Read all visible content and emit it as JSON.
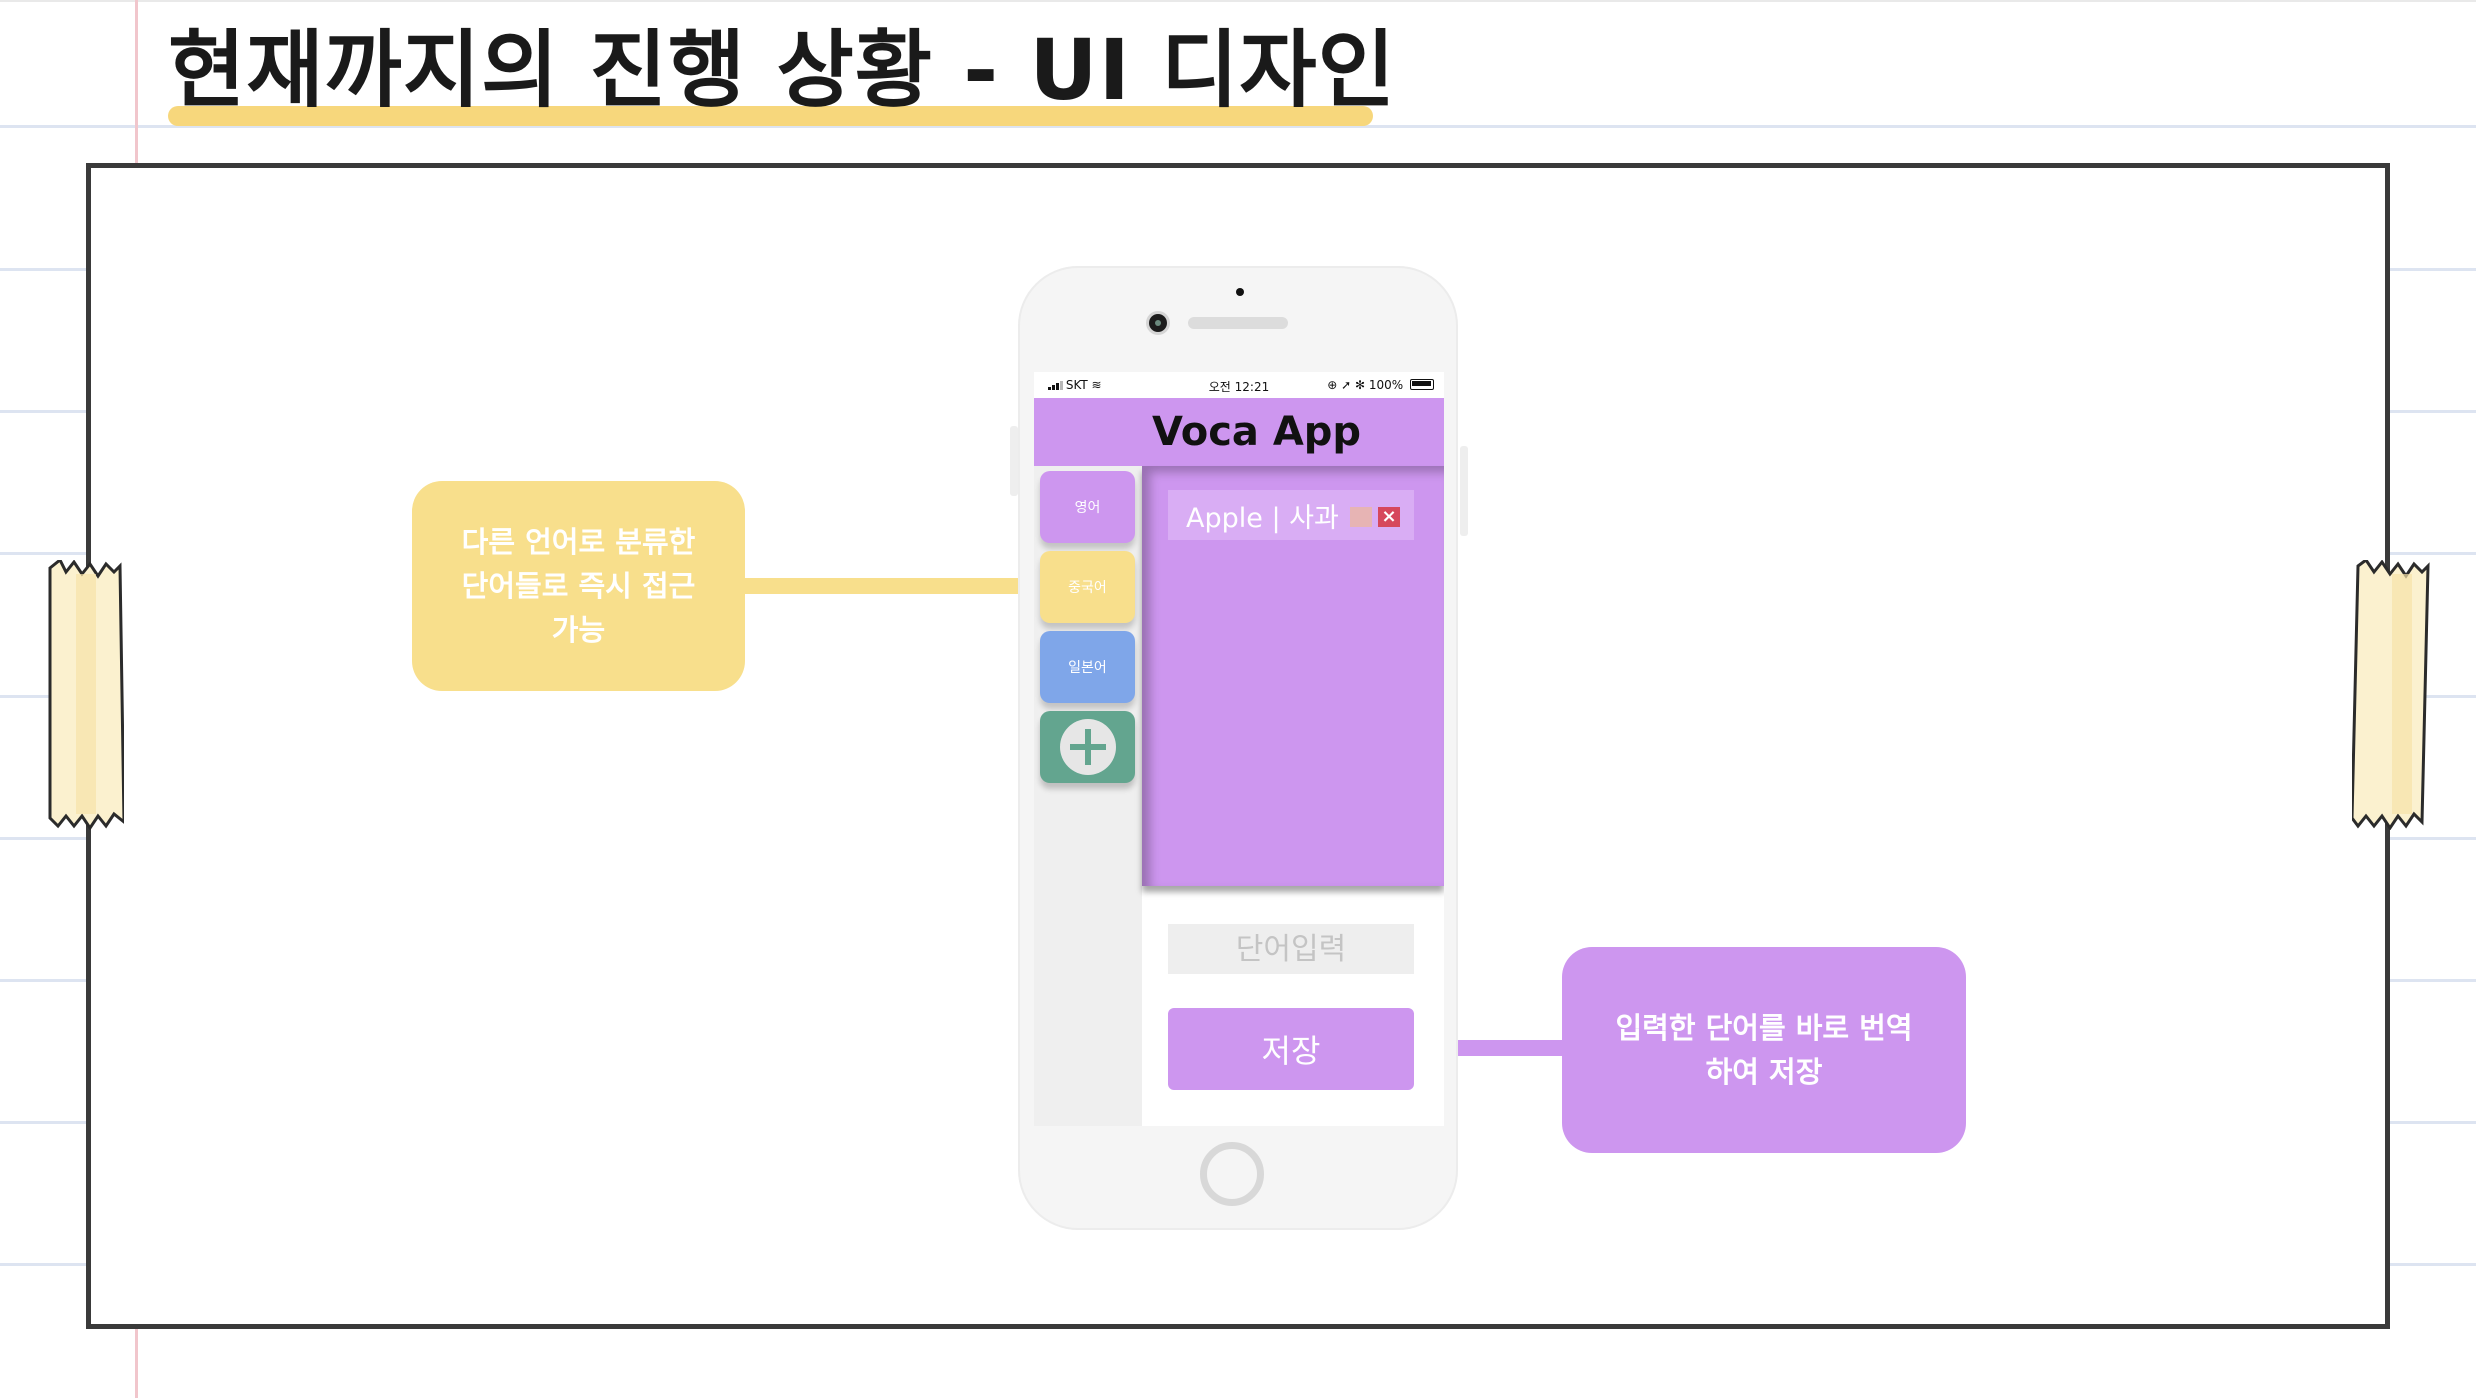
{
  "slide_title": "현재까지의 진행 상황 - UI 디자인",
  "phone": {
    "status_bar": {
      "carrier": "SKT",
      "time": "오전 12:21",
      "battery": "100%"
    },
    "app_title": "Voca App",
    "language_tabs": [
      {
        "label": "영어",
        "color": "#cd96ef"
      },
      {
        "label": "중국어",
        "color": "#f8df8c"
      },
      {
        "label": "일본어",
        "color": "#7fa6e9"
      }
    ],
    "add_language_icon": "plus-circle-icon",
    "word_entries": [
      {
        "text": "Apple | 사과",
        "edit_icon": "edit-square-icon",
        "delete_icon": "close-icon"
      }
    ],
    "word_input_placeholder": "단어입력",
    "save_label": "저장"
  },
  "callouts": {
    "left": "다른 언어로 분류한\n단어들로 즉시 접근\n가능",
    "right": "입력한 단어를 바로 번역\n하여 저장"
  },
  "colors": {
    "purple": "#cd96ef",
    "yellow": "#f8df8c",
    "blue": "#7fa6e9",
    "green": "#63a58f",
    "highlight": "#f7d77c"
  }
}
